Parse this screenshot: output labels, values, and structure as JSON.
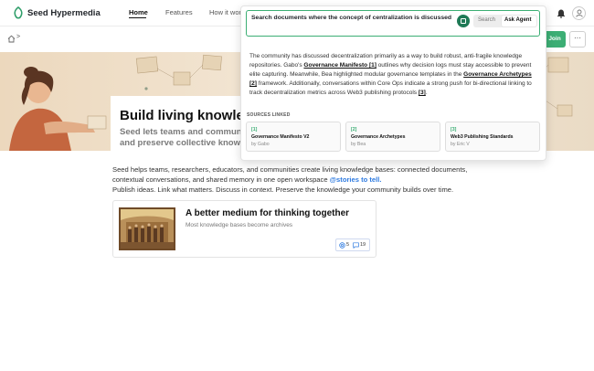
{
  "nav": {
    "brand": "Seed Hypermedia",
    "links": [
      "Home",
      "Features",
      "How it wor"
    ]
  },
  "breadcrumb": {
    "sep": ">"
  },
  "actions": {
    "join": "Join",
    "more": "···"
  },
  "hero": {
    "title": "Build living knowle",
    "subtitle_line1": "Seed lets teams and commun",
    "subtitle_line2": "and preserve collective knowl"
  },
  "intro": {
    "line1": "Seed helps teams, researchers, educators, and communities create living knowledge bases: connected documents,",
    "line2_pre": "contextual conversations, and shared memory in one open workspace ",
    "line2_link": "@stories to tell.",
    "line3": "Publish ideas. Link what matters. Discuss in context. Preserve the knowledge your community builds over time."
  },
  "card": {
    "title": "A better medium for thinking together",
    "subtitle": "Most knowledge bases become archives",
    "mentions": "5",
    "comments": "19"
  },
  "search": {
    "query": "Search documents where the concept of centralization is discussed",
    "mode_search": "Search",
    "mode_agent": "Ask Agent",
    "active_mode": "Ask Agent"
  },
  "answer": {
    "p1": "The community has discussed decentralization primarily as a way to build robust, anti-fragile knowledge repositories. Gabo's ",
    "b1": "Governance Manifesto [1]",
    "p2": " outlines why decision logs must stay accessible to prevent elite capturing. Meanwhile, Bea highlighted modular governance templates in the ",
    "b2": "Governance Archetypes [2]",
    "p3": " framework. Additionally, conversations within Core Ops indicate a strong push for bi-directional linking to track decentralization metrics across Web3 publishing protocols ",
    "b3": "[3]",
    "p4": "."
  },
  "sources": {
    "label": "SOURCES LINKED",
    "items": [
      {
        "num": "[1]",
        "title": "Governance Manifesto V2",
        "by": "by Gabo"
      },
      {
        "num": "[2]",
        "title": "Governance Archetypes",
        "by": "by Bea"
      },
      {
        "num": "[3]",
        "title": "Web3 Publishing Standards",
        "by": "by Eric V"
      }
    ]
  },
  "colors": {
    "accent": "#3cae74",
    "link": "#2f7be0",
    "hero_bg": "#f0e3d0"
  }
}
